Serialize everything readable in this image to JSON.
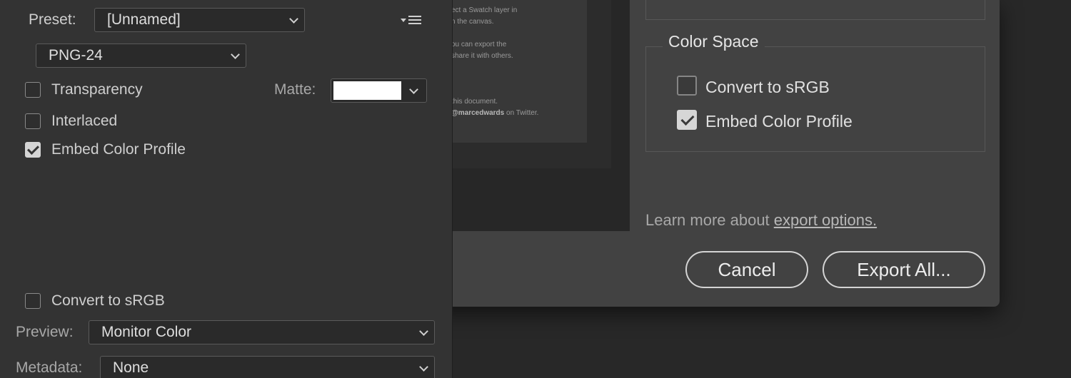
{
  "panel": {
    "preset_label": "Preset:",
    "preset_value": "[Unnamed]",
    "format_value": "PNG-24",
    "transparency_label": "Transparency",
    "transparency_checked": false,
    "matte_label": "Matte:",
    "matte_color": "#ffffff",
    "interlaced_label": "Interlaced",
    "interlaced_checked": false,
    "embed_profile_label": "Embed Color Profile",
    "embed_profile_checked": true,
    "convert_srgb_label": "Convert to sRGB",
    "convert_srgb_checked": false,
    "preview_label": "Preview:",
    "preview_value": "Monitor Color",
    "metadata_label": "Metadata:",
    "metadata_value": "None",
    "menu_icon": "panel-menu-icon"
  },
  "artboard": {
    "lines": [
      "ect a Swatch layer in",
      "n the canvas.",
      "ou can export the",
      "share it with others.",
      "this document.",
      "@marcedwards on Twitter."
    ],
    "handle": "@marcedwards",
    "handle_suffix": " on Twitter."
  },
  "dialog": {
    "color_space_title": "Color Space",
    "convert_srgb_label": "Convert to sRGB",
    "convert_srgb_checked": false,
    "embed_profile_label": "Embed Color Profile",
    "embed_profile_checked": true,
    "learn_more_prefix": "Learn more about ",
    "learn_more_link": "export options.",
    "cancel_label": "Cancel",
    "export_label": "Export All..."
  }
}
